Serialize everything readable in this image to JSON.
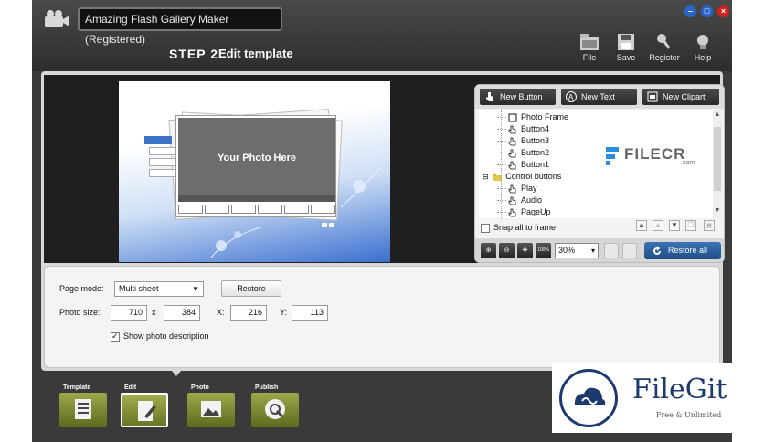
{
  "window": {
    "title": "Amazing Flash Gallery Maker (Registered)",
    "controls": [
      "minimize",
      "maximize",
      "close"
    ]
  },
  "step": {
    "number": "STEP 2",
    "title": "Edit template"
  },
  "toolbar": {
    "file_label": "File",
    "save_label": "Save",
    "register_label": "Register",
    "help_label": "Help"
  },
  "preview": {
    "photo_placeholder": "Your Photo Here"
  },
  "objects_panel": {
    "new_button_label": "New Button",
    "new_text_label": "New Text",
    "new_clipart_label": "New Clipart",
    "tree": [
      {
        "label": "Photo Frame",
        "icon": "frame-icon"
      },
      {
        "label": "Button4",
        "icon": "hand-cursor-icon"
      },
      {
        "label": "Button3",
        "icon": "hand-cursor-icon"
      },
      {
        "label": "Button2",
        "icon": "hand-cursor-icon"
      },
      {
        "label": "Button1",
        "icon": "hand-cursor-icon"
      },
      {
        "label": "Control buttons",
        "icon": "folder-icon"
      },
      {
        "label": "Play",
        "icon": "hand-cursor-icon"
      },
      {
        "label": "Audio",
        "icon": "hand-cursor-icon"
      },
      {
        "label": "PageUp",
        "icon": "hand-cursor-icon"
      }
    ],
    "snap_label": "Snap all to frame",
    "snap_checked": false,
    "zoom_value": "30%",
    "zoom_100_label": "100%",
    "restore_all_label": "Restore all"
  },
  "properties": {
    "page_mode_label": "Page mode:",
    "page_mode_value": "Multi sheet",
    "restore_label": "Restore",
    "photo_size_label": "Photo size:",
    "width": "710",
    "times": "x",
    "height": "384",
    "x_label": "X:",
    "x_value": "216",
    "y_label": "Y:",
    "y_value": "113",
    "show_desc_label": "Show photo description",
    "show_desc_checked": true
  },
  "nav": {
    "template_label": "Template",
    "edit_label": "Edit",
    "photo_label": "Photo",
    "publish_label": "Publish",
    "active": "Edit"
  },
  "watermarks": {
    "filecr_text": "FILECR",
    "filecr_sub": ".com",
    "filegit_text": "FileGit",
    "filegit_sub": "Free & Unlimited"
  }
}
